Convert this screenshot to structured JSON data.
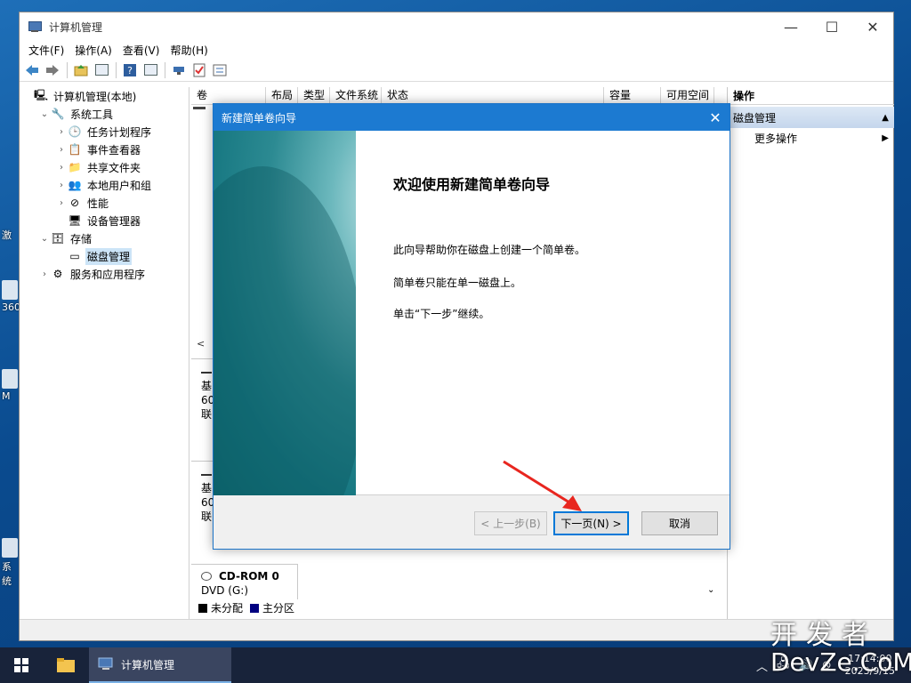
{
  "window": {
    "title": "计算机管理",
    "controls": {
      "minimize": "—",
      "maximize": "☐",
      "close": "✕"
    }
  },
  "menubar": [
    "文件(F)",
    "操作(A)",
    "查看(V)",
    "帮助(H)"
  ],
  "toolbar_icons": [
    "back-icon",
    "forward-icon",
    "up-folder-icon",
    "show-hide-tree-icon",
    "help-icon",
    "show-hide-action-icon",
    "connect-icon",
    "check-icon",
    "properties-icon"
  ],
  "tree": [
    {
      "label": "计算机管理(本地)",
      "indent": 0,
      "expander": "",
      "icon": "computer-icon"
    },
    {
      "label": "系统工具",
      "indent": 1,
      "expander": "⌄",
      "icon": "tools-icon"
    },
    {
      "label": "任务计划程序",
      "indent": 2,
      "expander": "›",
      "icon": "clock-icon"
    },
    {
      "label": "事件查看器",
      "indent": 2,
      "expander": "›",
      "icon": "event-viewer-icon"
    },
    {
      "label": "共享文件夹",
      "indent": 2,
      "expander": "›",
      "icon": "shared-folder-icon"
    },
    {
      "label": "本地用户和组",
      "indent": 2,
      "expander": "›",
      "icon": "users-icon"
    },
    {
      "label": "性能",
      "indent": 2,
      "expander": "›",
      "icon": "performance-icon"
    },
    {
      "label": "设备管理器",
      "indent": 2,
      "expander": "",
      "icon": "device-manager-icon"
    },
    {
      "label": "存储",
      "indent": 1,
      "expander": "⌄",
      "icon": "storage-icon"
    },
    {
      "label": "磁盘管理",
      "indent": 2,
      "expander": "",
      "icon": "disk-icon",
      "selected": true
    },
    {
      "label": "服务和应用程序",
      "indent": 1,
      "expander": "›",
      "icon": "services-icon"
    }
  ],
  "columns": [
    "卷",
    "布局",
    "类型",
    "文件系统",
    "状态",
    "容量",
    "可用空间"
  ],
  "disk_rows": [
    {
      "line1": "基",
      "line2": "60",
      "line3": "联"
    },
    {
      "line1": "基",
      "line2": "60",
      "line3": "联"
    }
  ],
  "cdrom": {
    "name": "CD-ROM 0",
    "sub": "DVD (G:)"
  },
  "legend": [
    {
      "label": "未分配",
      "color": "#000000"
    },
    {
      "label": "主分区",
      "color": "#000080"
    }
  ],
  "actions": {
    "header": "操作",
    "section": "磁盘管理",
    "more": "更多操作"
  },
  "dialog": {
    "title": "新建简单卷向导",
    "close": "✕",
    "heading": "欢迎使用新建简单卷向导",
    "lines": [
      "此向导帮助你在磁盘上创建一个简单卷。",
      "简单卷只能在单一磁盘上。",
      "单击“下一步”继续。"
    ],
    "back_label": "< 上一步(B)",
    "next_label": "下一页(N) >",
    "cancel_label": "取消"
  },
  "taskbar": {
    "task_label": "计算机管理",
    "tray_icons": [
      "chevron-up-icon",
      "network-icon",
      "volume-icon",
      "close-circle-icon"
    ],
    "time": "17:14:00",
    "date": "2023/9/15"
  },
  "watermark": {
    "line1": "开发者",
    "line2": "DevZe.CoM"
  },
  "desktop_fragments": [
    "激",
    "360",
    "M",
    "系统"
  ],
  "colors": {
    "accent": "#1c7ad1",
    "selection": "#cce4f7",
    "taskbar": "#18233a",
    "annotation_arrow": "#e8261f"
  }
}
